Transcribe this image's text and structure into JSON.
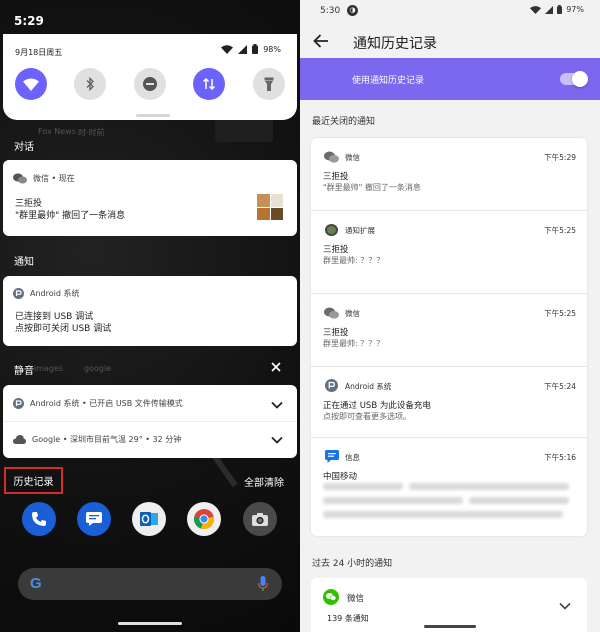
{
  "left": {
    "status_time": "5:29",
    "qs": {
      "date": "9月18日周五",
      "battery": "98%",
      "tiles": [
        {
          "name": "wifi",
          "on": true
        },
        {
          "name": "bluetooth",
          "on": false
        },
        {
          "name": "dnd",
          "on": false
        },
        {
          "name": "data",
          "on": true
        },
        {
          "name": "flashlight",
          "on": false
        }
      ]
    },
    "background_ghost_text": [
      "Fox News",
      "时·时前",
      "images",
      "google"
    ],
    "conversation_label": "对话",
    "conversation": {
      "app": "微信 • 现在",
      "title": "三拒投",
      "text": "\"群里最帅\" 撤回了一条消息"
    },
    "notifications_label": "通知",
    "android_card": {
      "app": "Android 系统",
      "line1": "已连接到 USB 调试",
      "line2": "点按即可关闭 USB 调试"
    },
    "silent_label": "静音",
    "silent_items": [
      {
        "text": "Android 系统 • 已开启 USB 文件传输模式"
      },
      {
        "text": "Google • 深圳市目前气温 29° • 32 分钟"
      }
    ],
    "history_button": "历史记录",
    "clear_all": "全部清除"
  },
  "right": {
    "status_time": "5:30",
    "battery": "97%",
    "title": "通知历史记录",
    "toggle_label": "使用通知历史记录",
    "toggle_on": true,
    "recent_section": "最近关闭的通知",
    "entries": [
      {
        "app": "微信",
        "time": "下午5:29",
        "title": "三拒投",
        "text": "\"群里最帅\" 撤回了一条消息",
        "icon": "wechat-icon"
      },
      {
        "app": "通知扩展",
        "time": "下午5:25",
        "title": "三拒投",
        "text": "群里最帅: ？？？",
        "icon": "extension-icon"
      },
      {
        "app": "微信",
        "time": "下午5:25",
        "title": "三拒投",
        "text": "群里最帅: ？？？",
        "icon": "wechat-icon"
      },
      {
        "app": "Android 系统",
        "time": "下午5:24",
        "title": "正在通过 USB 为此设备充电",
        "text": "点按即可查看更多选项。",
        "icon": "android-icon"
      },
      {
        "app": "信息",
        "time": "下午5:16",
        "title": "中国移动",
        "text": "",
        "icon": "messages-icon"
      }
    ],
    "past_section": "过去 24 小时的通知",
    "past_app": "微信",
    "past_count": "139 条通知"
  },
  "colors": {
    "accent": "#6c63ff",
    "toggle_bar": "#7b68ee",
    "highlight": "#d42b2b",
    "wechat_green": "#2dc100",
    "messages_blue": "#1a73e8"
  }
}
